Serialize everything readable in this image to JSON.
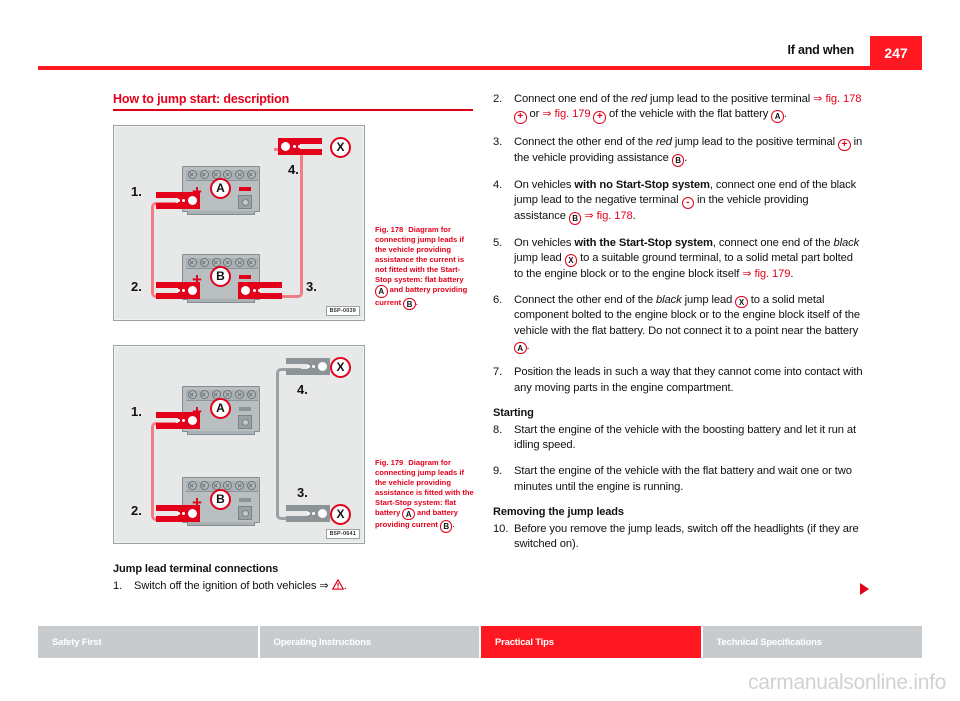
{
  "header": {
    "title": "If and when",
    "page_number": "247",
    "accent_color": "#ff1721"
  },
  "left_column": {
    "section_title": "How to jump start: description",
    "figures": [
      {
        "id": "B5P-0039",
        "caption_label": "Fig. 178",
        "caption_text": "Diagram for connecting jump leads if the vehicle providing assistance the current is not fitted with the Start-Stop system: flat battery Ⓐ and battery providing current Ⓑ.",
        "caption_part1": "Diagram for connecting jump leads if the vehicle providing assistance the current is not fitted with the Start-Stop system: flat battery ",
        "caption_part2": " and battery providing current ",
        "caption_part3": ".",
        "marker_a": "A",
        "marker_b": "B",
        "marker_x": "X",
        "steps": [
          "1.",
          "2.",
          "3.",
          "4."
        ],
        "battery_top_label": "A",
        "battery_bottom_label": "B"
      },
      {
        "id": "B5P-0641",
        "caption_label": "Fig. 179",
        "caption_text": "Diagram for connecting jump leads if the vehicle providing assistance is fitted with the Start-Stop system: flat battery Ⓐ and battery providing current Ⓑ.",
        "caption_part1": "Diagram for connecting jump leads if the vehicle providing assistance is fitted with the Start-Stop system: flat battery ",
        "caption_part2": " and battery providing current ",
        "caption_part3": ".",
        "marker_a": "A",
        "marker_b": "B",
        "marker_x": "X",
        "steps": [
          "1.",
          "2.",
          "3.",
          "4."
        ],
        "battery_top_label": "A",
        "battery_bottom_label": "B"
      }
    ],
    "subhead": "Jump lead terminal connections",
    "step1_num": "1.",
    "step1_text_a": "Switch off the ignition of both vehicles ⇒ ",
    "step1_text_b": "."
  },
  "right_column": {
    "steps": [
      {
        "num": "2.",
        "segments": [
          {
            "t": "Connect one end of the ",
            "s": "plain"
          },
          {
            "t": "red",
            "s": "italic"
          },
          {
            "t": " jump lead to the positive terminal ",
            "s": "plain"
          },
          {
            "t": "⇒ fig. 178",
            "s": "ref"
          },
          {
            "t": " ",
            "s": "plain"
          },
          {
            "t": "+",
            "s": "circle-red"
          },
          {
            "t": " or ",
            "s": "plain"
          },
          {
            "t": "⇒ fig. 179",
            "s": "ref"
          },
          {
            "t": " ",
            "s": "plain"
          },
          {
            "t": "+",
            "s": "circle-red"
          },
          {
            "t": " of the vehicle with the flat battery ",
            "s": "plain"
          },
          {
            "t": "A",
            "s": "circle"
          },
          {
            "t": ".",
            "s": "plain"
          }
        ]
      },
      {
        "num": "3.",
        "segments": [
          {
            "t": "Connect the other end of the ",
            "s": "plain"
          },
          {
            "t": "red",
            "s": "italic"
          },
          {
            "t": " jump lead to the positive terminal ",
            "s": "plain"
          },
          {
            "t": "+",
            "s": "circle-red"
          },
          {
            "t": " in the vehicle providing assistance ",
            "s": "plain"
          },
          {
            "t": "B",
            "s": "circle"
          },
          {
            "t": ".",
            "s": "plain"
          }
        ]
      },
      {
        "num": "4.",
        "segments": [
          {
            "t": "On vehicles ",
            "s": "plain"
          },
          {
            "t": "with no Start-Stop system",
            "s": "bold"
          },
          {
            "t": ", connect one end of the black jump lead to the negative terminal ",
            "s": "plain"
          },
          {
            "t": "-",
            "s": "circle-red"
          },
          {
            "t": " in the vehicle providing assistance ",
            "s": "plain"
          },
          {
            "t": "B",
            "s": "circle"
          },
          {
            "t": " ",
            "s": "plain"
          },
          {
            "t": "⇒ fig. 178",
            "s": "ref"
          },
          {
            "t": ".",
            "s": "plain"
          }
        ]
      },
      {
        "num": "5.",
        "segments": [
          {
            "t": "On vehicles ",
            "s": "plain"
          },
          {
            "t": "with the Start-Stop system",
            "s": "bold"
          },
          {
            "t": ", connect one end of the ",
            "s": "plain"
          },
          {
            "t": "black",
            "s": "italic"
          },
          {
            "t": " jump lead ",
            "s": "plain"
          },
          {
            "t": "X",
            "s": "circle"
          },
          {
            "t": " to a suitable ground terminal, to a solid metal part bolted to the engine block or to the engine block itself ",
            "s": "plain"
          },
          {
            "t": "⇒ fig. 179",
            "s": "ref"
          },
          {
            "t": ".",
            "s": "plain"
          }
        ]
      },
      {
        "num": "6.",
        "segments": [
          {
            "t": "Connect the other end of the ",
            "s": "plain"
          },
          {
            "t": "black",
            "s": "italic"
          },
          {
            "t": " jump lead ",
            "s": "plain"
          },
          {
            "t": "X",
            "s": "circle"
          },
          {
            "t": " to a solid metal component bolted to the engine block or to the engine block itself of the vehicle with the flat battery. Do not connect it to a point near the battery ",
            "s": "plain"
          },
          {
            "t": "A",
            "s": "circle"
          },
          {
            "t": ".",
            "s": "plain"
          }
        ]
      },
      {
        "num": "7.",
        "segments": [
          {
            "t": "Position the leads in such a way that they cannot come into contact with any moving parts in the engine compartment.",
            "s": "plain"
          }
        ]
      }
    ],
    "starting_head": "Starting",
    "starting_steps": [
      {
        "num": "8.",
        "segments": [
          {
            "t": "Start the engine of the vehicle with the boosting battery and let it run at idling speed.",
            "s": "plain"
          }
        ]
      },
      {
        "num": "9.",
        "segments": [
          {
            "t": "Start the engine of the vehicle with the flat battery and wait one or two minutes until the engine is running.",
            "s": "plain"
          }
        ]
      }
    ],
    "removing_head": "Removing the jump leads",
    "removing_steps": [
      {
        "num": "10.",
        "segments": [
          {
            "t": "Before you remove the jump leads, switch off the headlights (if they are switched on).",
            "s": "plain"
          }
        ]
      }
    ]
  },
  "footer": {
    "tabs": [
      {
        "label": "Safety First",
        "active": false
      },
      {
        "label": "Operating Instructions",
        "active": false
      },
      {
        "label": "Practical Tips",
        "active": true
      },
      {
        "label": "Technical Specifications",
        "active": false
      }
    ],
    "active_color": "#ff1721",
    "inactive_color": "#c8cbcd"
  },
  "watermark": "carmanualsonline.info"
}
